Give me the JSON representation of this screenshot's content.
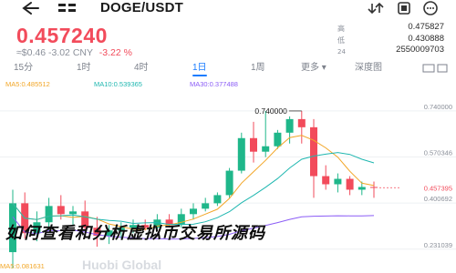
{
  "header": {
    "pair": "DOGE/USDT",
    "back_icon": "back-arrow-icon",
    "icons": [
      "compare-icon",
      "swap-icon",
      "bell-icon",
      "more-icon"
    ]
  },
  "ticker": {
    "last_price": "0.457240",
    "approx": "≈$0.46",
    "change": "-3.02 CNY",
    "change_pct": "-3.22 %",
    "high": "0.475827",
    "low": "0.430888",
    "volume_24h": "2550009703"
  },
  "tabs": {
    "items": [
      "15分",
      "1时",
      "4时",
      "1日",
      "1周",
      "更多",
      "深度图"
    ],
    "active": "1日"
  },
  "ma": {
    "ma5": "MA5:0.485512",
    "ma10": "MA10:0.539365",
    "ma30": "MA30:0.377488"
  },
  "chart_data": {
    "type": "candlestick",
    "y_ticks": [
      "0.740000",
      "0.570346",
      "0.400692",
      "0.231039"
    ],
    "current_price_label": "0.457395",
    "max_label": "0.740000",
    "candles": [
      {
        "o": 0.22,
        "h": 0.45,
        "l": 0.16,
        "c": 0.4
      },
      {
        "o": 0.4,
        "h": 0.44,
        "l": 0.27,
        "c": 0.29
      },
      {
        "o": 0.29,
        "h": 0.37,
        "l": 0.26,
        "c": 0.33
      },
      {
        "o": 0.33,
        "h": 0.42,
        "l": 0.3,
        "c": 0.39
      },
      {
        "o": 0.39,
        "h": 0.43,
        "l": 0.34,
        "c": 0.36
      },
      {
        "o": 0.36,
        "h": 0.39,
        "l": 0.32,
        "c": 0.37
      },
      {
        "o": 0.37,
        "h": 0.41,
        "l": 0.3,
        "c": 0.31
      },
      {
        "o": 0.31,
        "h": 0.35,
        "l": 0.24,
        "c": 0.28
      },
      {
        "o": 0.28,
        "h": 0.32,
        "l": 0.25,
        "c": 0.3
      },
      {
        "o": 0.3,
        "h": 0.33,
        "l": 0.27,
        "c": 0.31
      },
      {
        "o": 0.31,
        "h": 0.34,
        "l": 0.29,
        "c": 0.32
      },
      {
        "o": 0.32,
        "h": 0.34,
        "l": 0.3,
        "c": 0.31
      },
      {
        "o": 0.31,
        "h": 0.36,
        "l": 0.3,
        "c": 0.34
      },
      {
        "o": 0.34,
        "h": 0.36,
        "l": 0.31,
        "c": 0.32
      },
      {
        "o": 0.32,
        "h": 0.38,
        "l": 0.31,
        "c": 0.36
      },
      {
        "o": 0.36,
        "h": 0.4,
        "l": 0.34,
        "c": 0.38
      },
      {
        "o": 0.38,
        "h": 0.42,
        "l": 0.37,
        "c": 0.4
      },
      {
        "o": 0.4,
        "h": 0.44,
        "l": 0.39,
        "c": 0.43
      },
      {
        "o": 0.43,
        "h": 0.53,
        "l": 0.42,
        "c": 0.52
      },
      {
        "o": 0.52,
        "h": 0.66,
        "l": 0.51,
        "c": 0.64
      },
      {
        "o": 0.64,
        "h": 0.7,
        "l": 0.55,
        "c": 0.59
      },
      {
        "o": 0.59,
        "h": 0.74,
        "l": 0.57,
        "c": 0.61
      },
      {
        "o": 0.61,
        "h": 0.67,
        "l": 0.6,
        "c": 0.66
      },
      {
        "o": 0.66,
        "h": 0.72,
        "l": 0.62,
        "c": 0.71
      },
      {
        "o": 0.71,
        "h": 0.74,
        "l": 0.62,
        "c": 0.68
      },
      {
        "o": 0.68,
        "h": 0.71,
        "l": 0.42,
        "c": 0.5
      },
      {
        "o": 0.5,
        "h": 0.54,
        "l": 0.45,
        "c": 0.47
      },
      {
        "o": 0.47,
        "h": 0.51,
        "l": 0.44,
        "c": 0.49
      },
      {
        "o": 0.49,
        "h": 0.5,
        "l": 0.43,
        "c": 0.45
      },
      {
        "o": 0.45,
        "h": 0.48,
        "l": 0.43,
        "c": 0.46
      },
      {
        "o": 0.46,
        "h": 0.48,
        "l": 0.42,
        "c": 0.457
      }
    ],
    "ylim": [
      0.17,
      0.78
    ]
  },
  "overlay_text": "如何查看和分析虚拟币交易所源码",
  "footer_ma": "MA5:0.081631",
  "watermark": "Huobi Global",
  "colors": {
    "up": "#1fb78a",
    "down": "#f24b5b",
    "accent": "#1a7cff",
    "ma5": "#f2a627",
    "ma10": "#1fb7b0",
    "ma30": "#8b5cf6"
  }
}
